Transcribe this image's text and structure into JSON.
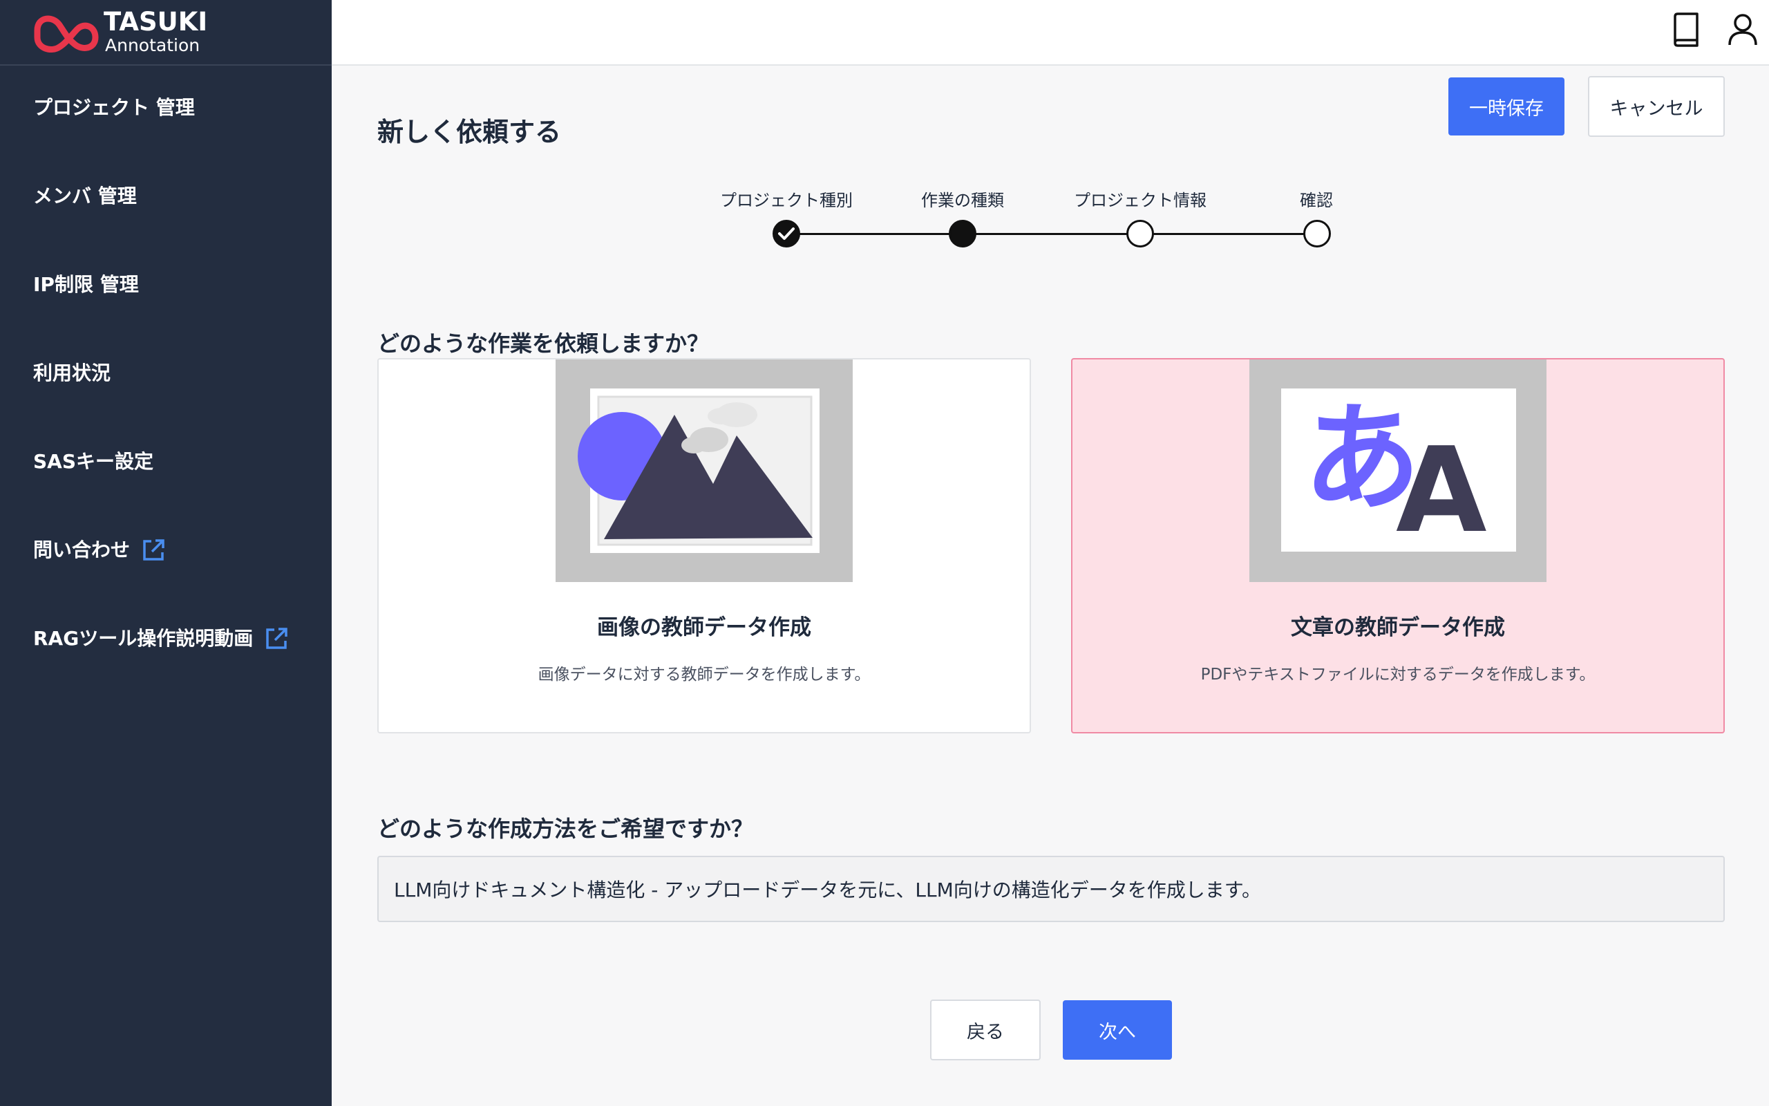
{
  "brand": {
    "name": "TASUKI",
    "sub": "Annotation",
    "color": "#e8364b"
  },
  "sidebar": {
    "items": [
      {
        "label": "プロジェクト 管理",
        "external": false
      },
      {
        "label": "メンバ 管理",
        "external": false
      },
      {
        "label": "IP制限 管理",
        "external": false
      },
      {
        "label": "利用状況",
        "external": false
      },
      {
        "label": "SASキー設定",
        "external": false
      },
      {
        "label": "問い合わせ",
        "external": true
      },
      {
        "label": "RAGツール操作説明動画",
        "external": true
      }
    ]
  },
  "topbar": {
    "icons": [
      "book-icon",
      "user-icon"
    ]
  },
  "header": {
    "title": "新しく依頼する",
    "save_label": "一時保存",
    "cancel_label": "キャンセル"
  },
  "stepper": {
    "steps": [
      {
        "label": "プロジェクト種別",
        "state": "done"
      },
      {
        "label": "作業の種類",
        "state": "current"
      },
      {
        "label": "プロジェクト情報",
        "state": "todo"
      },
      {
        "label": "確認",
        "state": "todo"
      }
    ]
  },
  "work_type": {
    "question": "どのような作業を依頼しますか？",
    "options": [
      {
        "title": "画像の教師データ作成",
        "description": "画像データに対する教師データを作成します。",
        "selected": false,
        "illustration": "image-landscape-icon"
      },
      {
        "title": "文章の教師データ作成",
        "description": "PDFやテキストファイルに対するデータを作成します。",
        "selected": true,
        "illustration": "text-translate-icon",
        "glyph_a": "あ",
        "glyph_b": "A"
      }
    ]
  },
  "method": {
    "question": "どのような作成方法をご希望ですか？",
    "value": "LLM向けドキュメント構造化 - アップロードデータを元に、LLM向けの構造化データを作成します。"
  },
  "footer": {
    "back_label": "戻る",
    "next_label": "次へ"
  },
  "colors": {
    "sidebar_bg": "#232d40",
    "primary": "#3e6ff5",
    "selected_bg": "#fde0e6",
    "selected_border": "#f08aa4",
    "accent_purple": "#6c63ff"
  }
}
